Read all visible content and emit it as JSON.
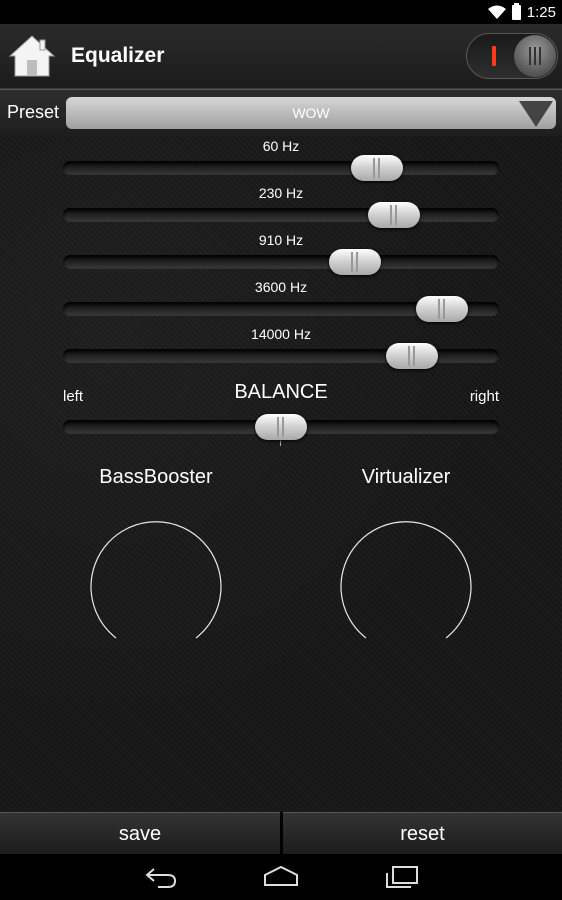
{
  "status_bar": {
    "time": "1:25",
    "icons": [
      "wifi-icon",
      "battery-icon"
    ]
  },
  "header": {
    "title": "Equalizer",
    "home_icon": "home-icon",
    "power_toggle": "on"
  },
  "preset": {
    "label": "Preset",
    "value": "WOW"
  },
  "bands": [
    {
      "label": "60 Hz",
      "level": 0.72
    },
    {
      "label": "230 Hz",
      "level": 0.76
    },
    {
      "label": "910 Hz",
      "level": 0.67
    },
    {
      "label": "3600 Hz",
      "level": 0.87
    },
    {
      "label": "14000 Hz",
      "level": 0.8
    }
  ],
  "balance": {
    "title": "BALANCE",
    "left_label": "left",
    "right_label": "right",
    "level": 0.5
  },
  "effects": {
    "bass_label": "BassBooster",
    "virtualizer_label": "Virtualizer"
  },
  "buttons": {
    "save": "save",
    "reset": "reset"
  },
  "nav": [
    "back-icon",
    "home-nav-icon",
    "recents-icon"
  ],
  "colors": {
    "power_accent": "#ff3a1a",
    "background": "#161616"
  }
}
